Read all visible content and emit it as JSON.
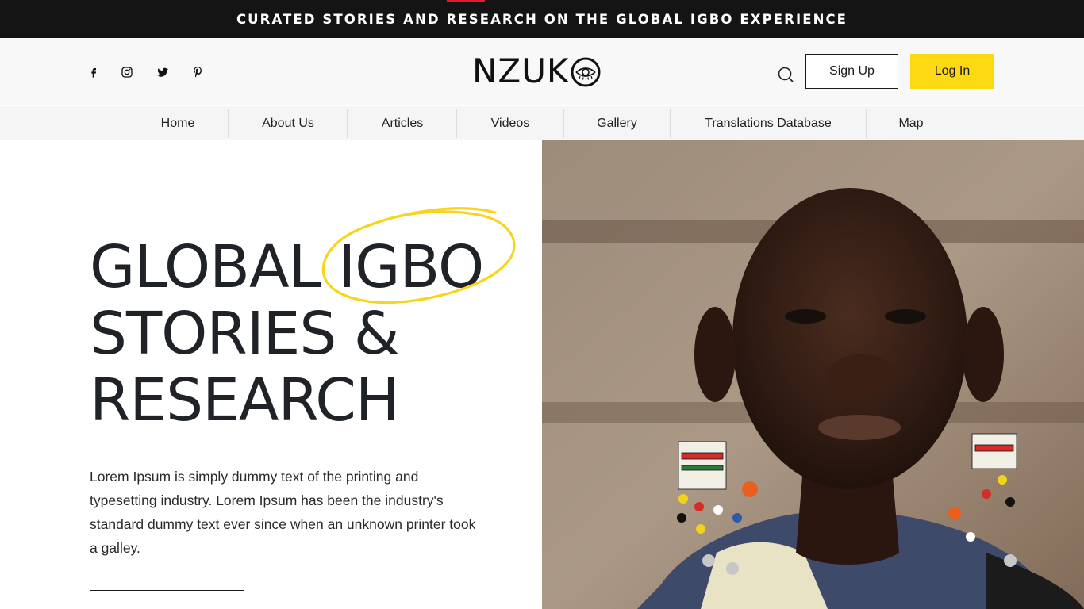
{
  "banner": {
    "text": "CURATED STORIES AND RESEARCH ON THE GLOBAL IGBO EXPERIENCE"
  },
  "header": {
    "social": [
      {
        "icon": "facebook-icon"
      },
      {
        "icon": "instagram-icon"
      },
      {
        "icon": "twitter-icon"
      },
      {
        "icon": "pinterest-icon"
      }
    ],
    "logo_text": "NZUK",
    "logo_icon": "eye-o-logo-icon",
    "search_icon": "search-icon",
    "signup_label": "Sign Up",
    "login_label": "Log In"
  },
  "nav": {
    "items": [
      {
        "label": "Home"
      },
      {
        "label": "About Us"
      },
      {
        "label": "Articles"
      },
      {
        "label": "Videos"
      },
      {
        "label": "Gallery"
      },
      {
        "label": "Translations Database"
      },
      {
        "label": "Map"
      }
    ]
  },
  "hero": {
    "title_line1": "GLOBAL IGBO",
    "title_line2": "STORIES &",
    "title_line3": "RESEARCH",
    "description": "Lorem Ipsum is simply dummy text of the printing and typesetting industry. Lorem Ipsum has been the industry's standard dummy text ever since when an unknown printer took a galley."
  },
  "colors": {
    "banner_bg": "#141414",
    "accent_yellow": "#fcd912",
    "accent_red": "#e11d2a",
    "text_dark": "#1f2328"
  }
}
